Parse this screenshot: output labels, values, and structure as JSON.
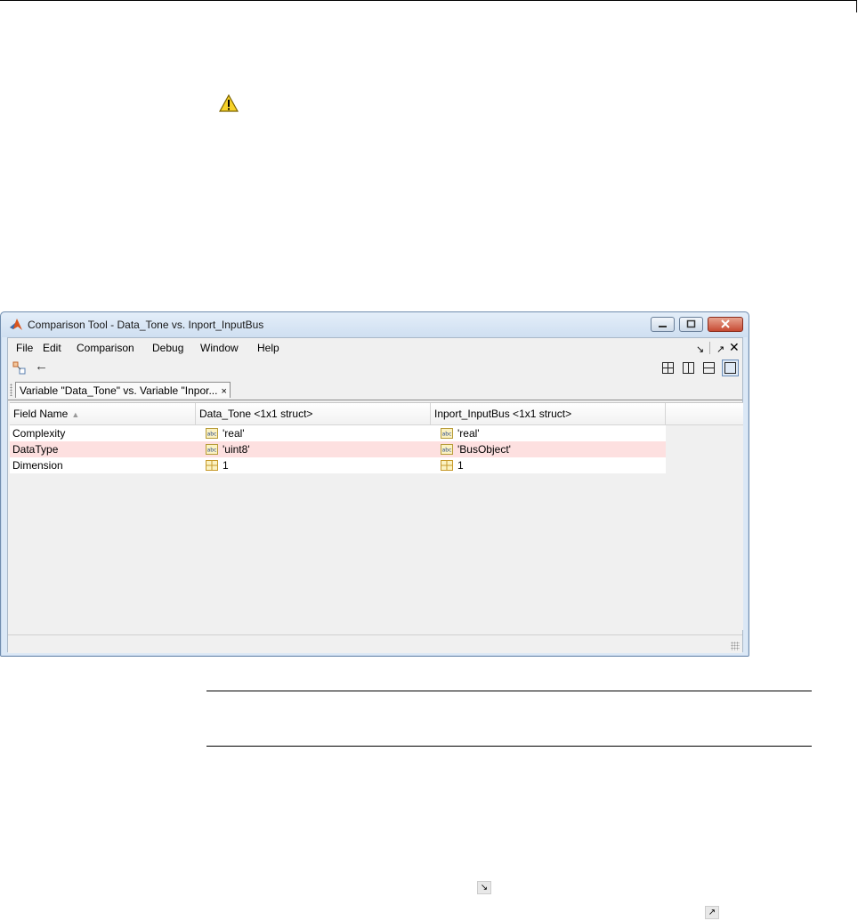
{
  "window": {
    "title": "Comparison Tool - Data_Tone vs. Inport_InputBus"
  },
  "menubar": {
    "items": [
      "File",
      "Edit",
      "Comparison",
      "Debug",
      "Window",
      "Help"
    ],
    "undock_glyph": "↘",
    "maximize_glyph": "↗",
    "close_glyph": "✕"
  },
  "toolbar": {
    "back_glyph": "←"
  },
  "tab": {
    "label": "Variable \"Data_Tone\" vs. Variable \"Inpor...",
    "close_glyph": "×"
  },
  "table": {
    "headers": [
      "Field Name",
      "Data_Tone <1x1 struct>",
      "Inport_InputBus <1x1 struct>",
      ""
    ],
    "sort_glyph": "▲",
    "rows": [
      {
        "field": "Complexity",
        "left": "'real'",
        "right": "'real'",
        "icon": "abc-icon",
        "diff": false
      },
      {
        "field": "DataType",
        "left": "'uint8'",
        "right": "'BusObject'",
        "icon": "abc-icon",
        "diff": true
      },
      {
        "field": "Dimension",
        "left": "1",
        "right": "1",
        "icon": "grid-icon",
        "diff": false
      }
    ]
  },
  "inline_icons": {
    "undock_glyph": "↘",
    "dock_glyph": "↗"
  },
  "colors": {
    "diff_row": "#fde0e0",
    "title_bar": "#dbe8f6",
    "close_button": "#c74a33"
  }
}
